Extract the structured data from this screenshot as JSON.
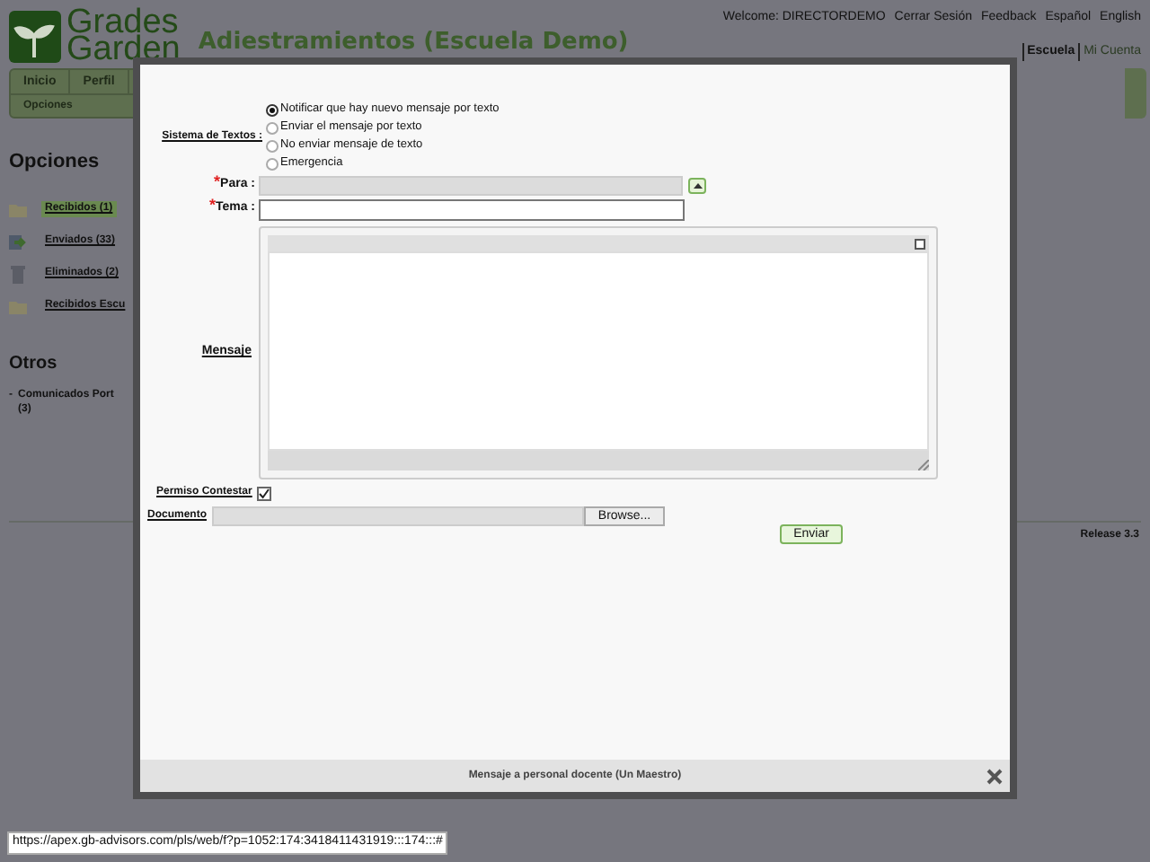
{
  "header": {
    "logo_lines": [
      "Grades",
      "Garden"
    ],
    "title": "Adiestramientos (Escuela Demo)",
    "welcome": "Welcome: DIRECTORDEMO",
    "top_links": [
      "Cerrar Sesión",
      "Feedback",
      "Español",
      "English"
    ],
    "sub_links": [
      {
        "label": "Escuela",
        "selected": true
      },
      {
        "label": "Mi Cuenta",
        "selected": false
      }
    ]
  },
  "nav": {
    "tabs": [
      {
        "label": "Inicio",
        "selected": false
      },
      {
        "label": "Perfil",
        "selected": false
      }
    ],
    "subtab": "Opciones"
  },
  "sidebar": {
    "heading": "Opciones",
    "items": [
      {
        "label": "Recibidos (1)",
        "kind": "folder",
        "selected": true
      },
      {
        "label": "Enviados (33)",
        "kind": "sent",
        "selected": false
      },
      {
        "label": "Eliminados (2)",
        "kind": "trash",
        "selected": false
      },
      {
        "label": "Recibidos Escu",
        "kind": "folder",
        "selected": false
      }
    ],
    "other_heading": "Otros",
    "other_items": [
      {
        "bullet": "-",
        "label": "Comunicados Port",
        "count": "(3)"
      }
    ]
  },
  "release": "Release 3.3",
  "dialog": {
    "sms_label": "Sistema de Textos :",
    "sms_options": [
      {
        "label": "Notificar que hay nuevo mensaje por texto",
        "selected": true
      },
      {
        "label": "Enviar el mensaje por texto",
        "selected": false
      },
      {
        "label": "No enviar mensaje de texto",
        "selected": false
      },
      {
        "label": "Emergencia",
        "selected": false
      }
    ],
    "to_label": "Para :",
    "to_marker": "*",
    "subject_label": "Tema :",
    "subject_marker": "*",
    "message_label": "Mensaje",
    "reply_label": "Permiso Contestar",
    "reply_checked": true,
    "document_label": "Documento",
    "browse": "Browse...",
    "send": "Enviar",
    "footer_title": "Mensaje a personal docente (Un Maestro)"
  },
  "status_url": "https://apex.gb-advisors.com/pls/web/f?p=1052:174:3418411431919:::174:::#"
}
